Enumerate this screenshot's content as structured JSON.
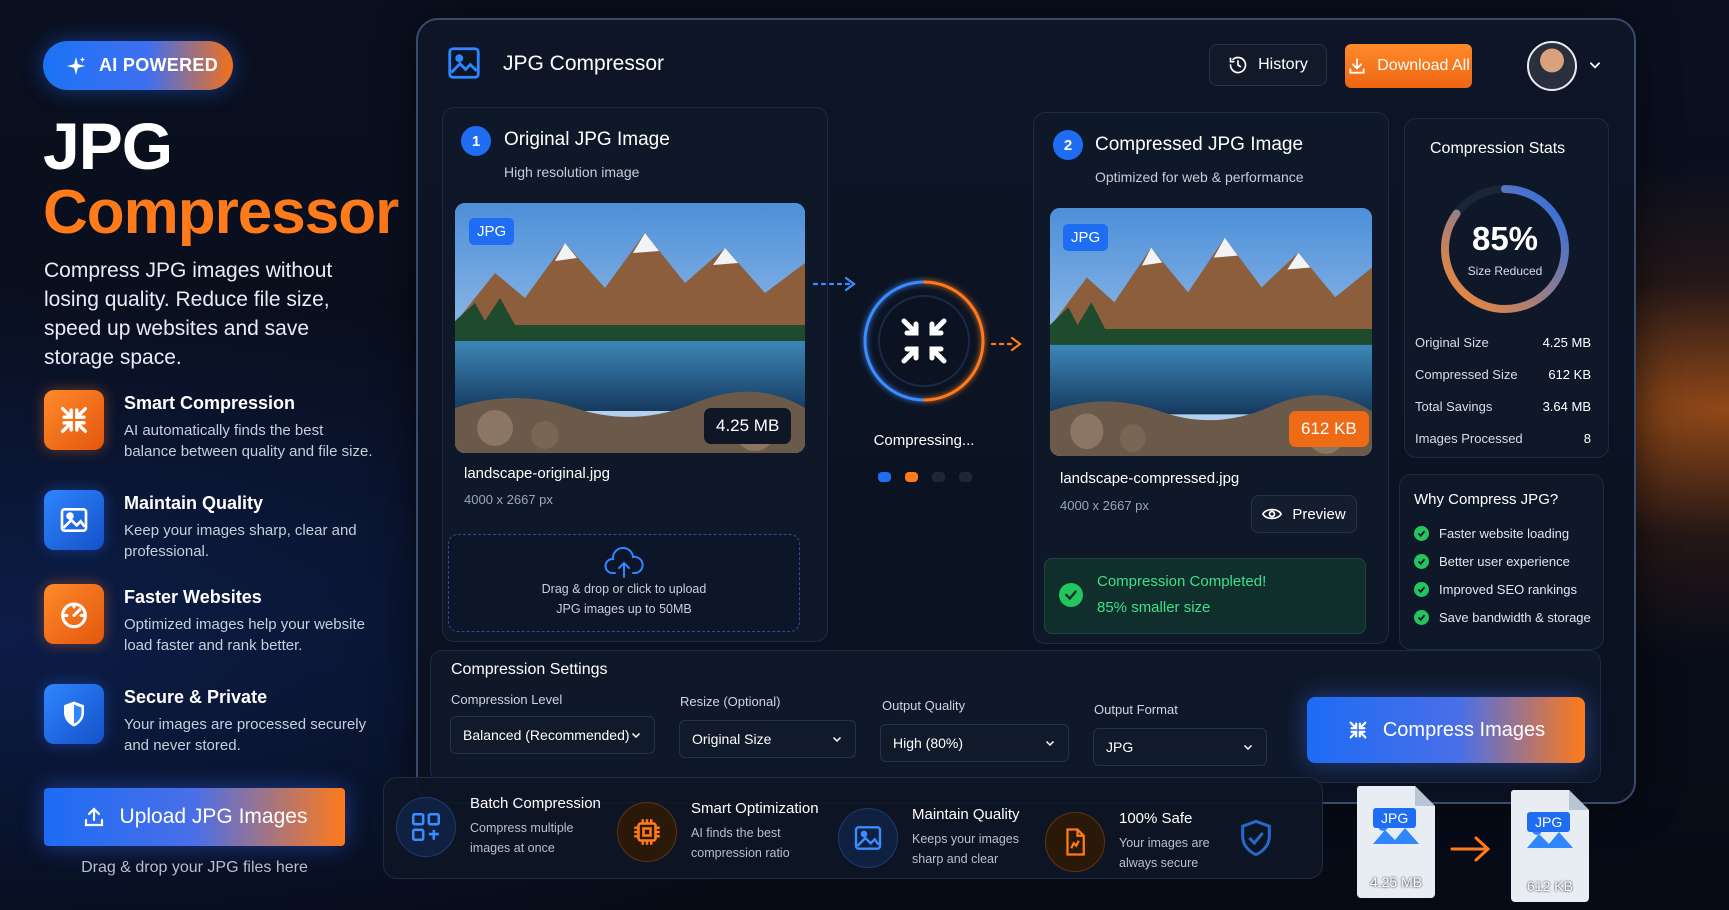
{
  "hero": {
    "badge": "AI POWERED",
    "title_line1": "JPG",
    "title_line2": "Compressor",
    "description": "Compress JPG images without losing quality. Reduce file size, speed up websites and save storage space.",
    "features": [
      {
        "title": "Smart Compression",
        "desc": "AI automatically finds the best balance between quality and file size.",
        "icon": "compress-icon"
      },
      {
        "title": "Maintain Quality",
        "desc": "Keep your images sharp, clear and professional.",
        "icon": "image-icon"
      },
      {
        "title": "Faster Websites",
        "desc": "Optimized images help your website load faster and rank better.",
        "icon": "speed-icon"
      },
      {
        "title": "Secure & Private",
        "desc": "Your images are processed securely and never stored.",
        "icon": "shield-icon"
      }
    ],
    "upload_button": "Upload JPG Images",
    "upload_hint": "Drag & drop your JPG files here"
  },
  "app": {
    "title": "JPG Compressor",
    "history_button": "History",
    "download_button": "Download All"
  },
  "original": {
    "step": "1",
    "title": "Original JPG Image",
    "subtitle": "High resolution image",
    "format_chip": "JPG",
    "size": "4.25 MB",
    "filename": "landscape-original.jpg",
    "dimensions": "4000 x 2667 px",
    "dropzone_line1": "Drag & drop or click to upload",
    "dropzone_line2": "JPG images up to 50MB"
  },
  "process": {
    "status": "Compressing..."
  },
  "compressed": {
    "step": "2",
    "title": "Compressed JPG Image",
    "subtitle": "Optimized for web & performance",
    "format_chip": "JPG",
    "size": "612 KB",
    "filename": "landscape-compressed.jpg",
    "dimensions": "4000 x 2667 px",
    "preview_button": "Preview",
    "success_title": "Compression Completed!",
    "success_sub": "85% smaller size"
  },
  "stats": {
    "title": "Compression Stats",
    "percent": "85%",
    "percent_value": 0.85,
    "percent_label": "Size Reduced",
    "rows": [
      {
        "label": "Original Size",
        "value": "4.25 MB"
      },
      {
        "label": "Compressed Size",
        "value": "612 KB"
      },
      {
        "label": "Total Savings",
        "value": "3.64 MB"
      },
      {
        "label": "Images Processed",
        "value": "8"
      }
    ]
  },
  "why": {
    "title": "Why Compress JPG?",
    "items": [
      "Faster website loading",
      "Better user experience",
      "Improved SEO rankings",
      "Save bandwidth & storage"
    ]
  },
  "settings": {
    "title": "Compression Settings",
    "fields": [
      {
        "label": "Compression Level",
        "value": "Balanced (Recommended)"
      },
      {
        "label": "Resize (Optional)",
        "value": "Original Size"
      },
      {
        "label": "Output Quality",
        "value": "High (80%)"
      },
      {
        "label": "Output Format",
        "value": "JPG"
      }
    ],
    "compress_button": "Compress Images"
  },
  "bottom": {
    "items": [
      {
        "title": "Batch Compression",
        "desc1": "Compress multiple",
        "desc2": "images at once"
      },
      {
        "title": "Smart Optimization",
        "desc1": "AI finds the best",
        "desc2": "compression ratio"
      },
      {
        "title": "Maintain Quality",
        "desc1": "Keeps your images",
        "desc2": "sharp and clear"
      },
      {
        "title": "100% Safe",
        "desc1": "Your images are",
        "desc2": "always secure"
      }
    ]
  },
  "files": {
    "before_label": "JPG",
    "before_size": "4.25 MB",
    "after_label": "JPG",
    "after_size": "612 KB"
  },
  "colors": {
    "accent_blue": "#1f6df2",
    "accent_orange": "#ff7a1a",
    "success": "#22c55e"
  }
}
